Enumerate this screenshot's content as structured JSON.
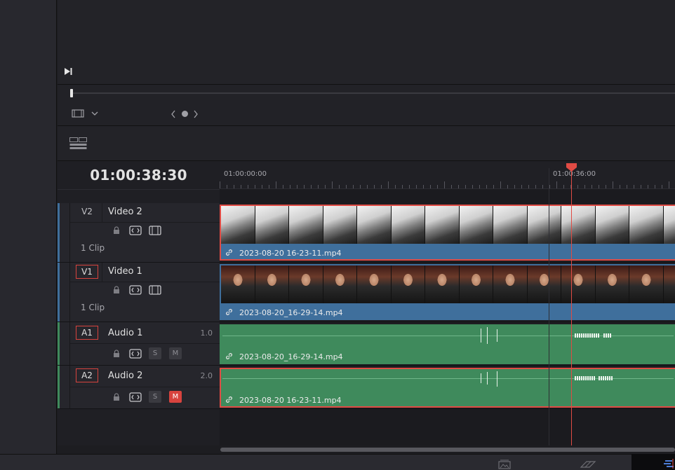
{
  "timecode": "01:00:38:30",
  "ruler": {
    "label_start": "01:00:00:00",
    "label_mid": "01:00:36:00"
  },
  "colors": {
    "video_track": "#3f6f9c",
    "audio_track": "#3f8a5c",
    "selection": "#e04b44",
    "playhead": "#e04b44"
  },
  "tracks": [
    {
      "id": "V2",
      "name": "Video 2",
      "clip_count": "1 Clip",
      "icons": [
        "lock-icon",
        "auto-select-icon",
        "video-toggle-icon"
      ],
      "clip": {
        "name": "2023-08-20 16-23-11.mp4",
        "selected": true
      }
    },
    {
      "id": "V1",
      "name": "Video 1",
      "clip_count": "1 Clip",
      "icons": [
        "lock-icon",
        "auto-select-icon",
        "video-toggle-icon"
      ],
      "clip": {
        "name": "2023-08-20_16-29-14.mp4",
        "selected": false
      }
    },
    {
      "id": "A1",
      "name": "Audio 1",
      "channel": "1.0",
      "solo": "S",
      "mute": "M",
      "mute_on": false,
      "clip": {
        "name": "2023-08-20_16-29-14.mp4",
        "selected": false
      }
    },
    {
      "id": "A2",
      "name": "Audio 2",
      "channel": "2.0",
      "solo": "S",
      "mute": "M",
      "mute_on": true,
      "clip": {
        "name": "2023-08-20 16-23-11.mp4",
        "selected": true
      }
    }
  ]
}
